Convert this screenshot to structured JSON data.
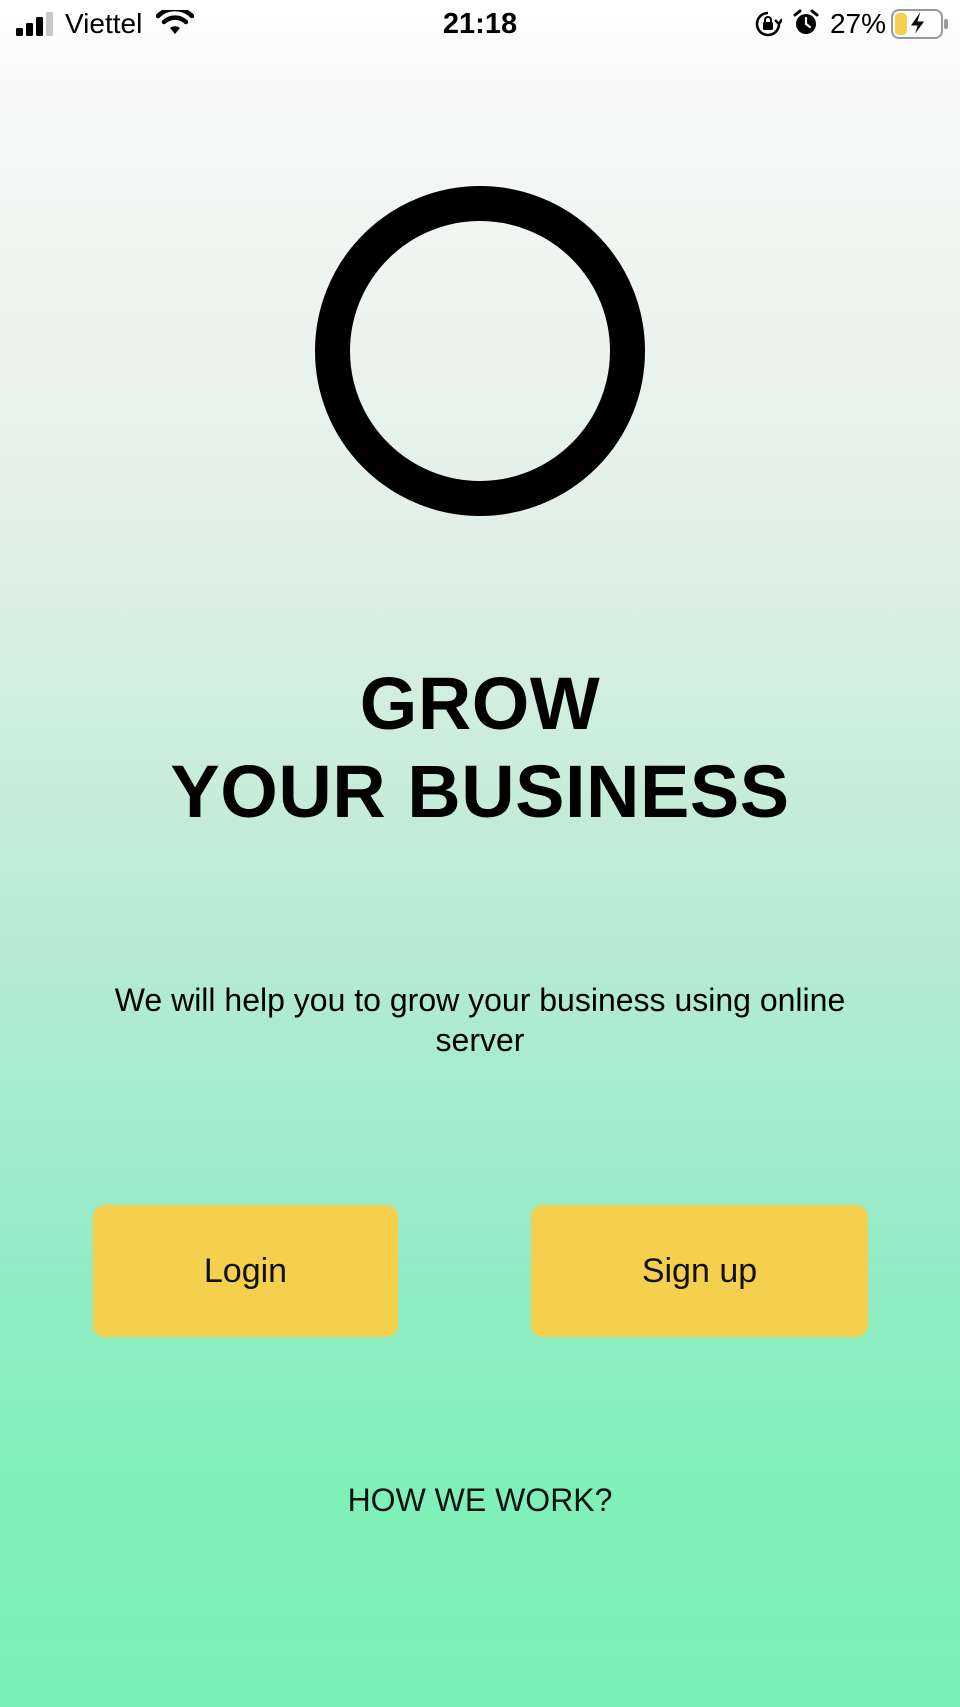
{
  "status_bar": {
    "carrier": "Viettel",
    "time": "21:18",
    "battery_percent": "27%",
    "battery_level": 0.27,
    "icons": [
      "signal-icon",
      "wifi-icon",
      "rotation-lock-icon",
      "alarm-icon",
      "battery-charging-icon"
    ]
  },
  "logo": {
    "icon": "ring-logo-icon"
  },
  "hero": {
    "headline_line1": "GROW",
    "headline_line2": "YOUR BUSINESS",
    "tagline": "We will help you to grow your business using online server"
  },
  "actions": {
    "login_label": "Login",
    "signup_label": "Sign up"
  },
  "footer": {
    "how_we_work_label": "HOW WE WORK?"
  },
  "colors": {
    "button_bg": "#f5cf4e",
    "gradient_top": "#ffffff",
    "gradient_bottom": "#78f1b6",
    "text": "#000000"
  }
}
